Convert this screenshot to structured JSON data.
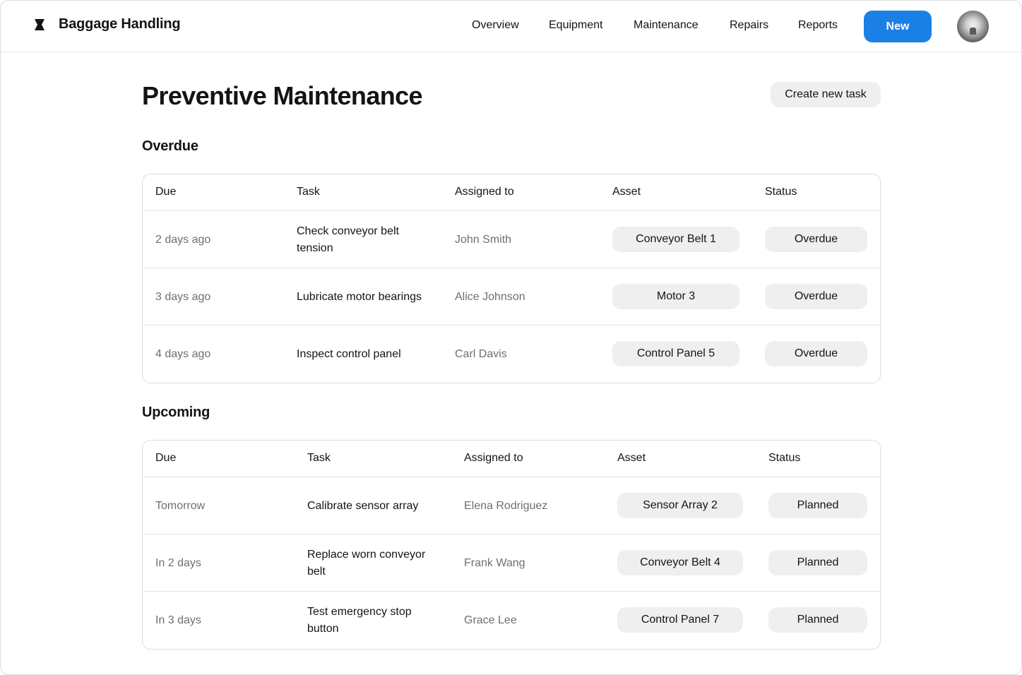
{
  "header": {
    "brand": "Baggage Handling",
    "nav": [
      "Overview",
      "Equipment",
      "Maintenance",
      "Repairs",
      "Reports"
    ],
    "new_label": "New"
  },
  "page": {
    "title": "Preventive Maintenance",
    "create_label": "Create new task"
  },
  "columns": [
    "Due",
    "Task",
    "Assigned to",
    "Asset",
    "Status"
  ],
  "overdue": {
    "title": "Overdue",
    "rows": [
      {
        "due": "2 days ago",
        "task": "Check conveyor belt tension",
        "assigned": "John Smith",
        "asset": "Conveyor Belt 1",
        "status": "Overdue"
      },
      {
        "due": "3 days ago",
        "task": "Lubricate motor bearings",
        "assigned": "Alice Johnson",
        "asset": "Motor 3",
        "status": "Overdue"
      },
      {
        "due": "4 days ago",
        "task": "Inspect control panel",
        "assigned": "Carl Davis",
        "asset": "Control Panel 5",
        "status": "Overdue"
      }
    ]
  },
  "upcoming": {
    "title": "Upcoming",
    "rows": [
      {
        "due": "Tomorrow",
        "task": "Calibrate sensor array",
        "assigned": "Elena Rodriguez",
        "asset": "Sensor Array 2",
        "status": "Planned"
      },
      {
        "due": "In 2 days",
        "task": "Replace worn conveyor belt",
        "assigned": "Frank Wang",
        "asset": "Conveyor Belt 4",
        "status": "Planned"
      },
      {
        "due": "In 3 days",
        "task": "Test emergency stop button",
        "assigned": "Grace Lee",
        "asset": "Control Panel 7",
        "status": "Planned"
      }
    ]
  },
  "colors": {
    "accent": "#1a80e5",
    "pill_bg": "#efefef",
    "muted_text": "#6f6f6f",
    "border": "#dedede"
  }
}
